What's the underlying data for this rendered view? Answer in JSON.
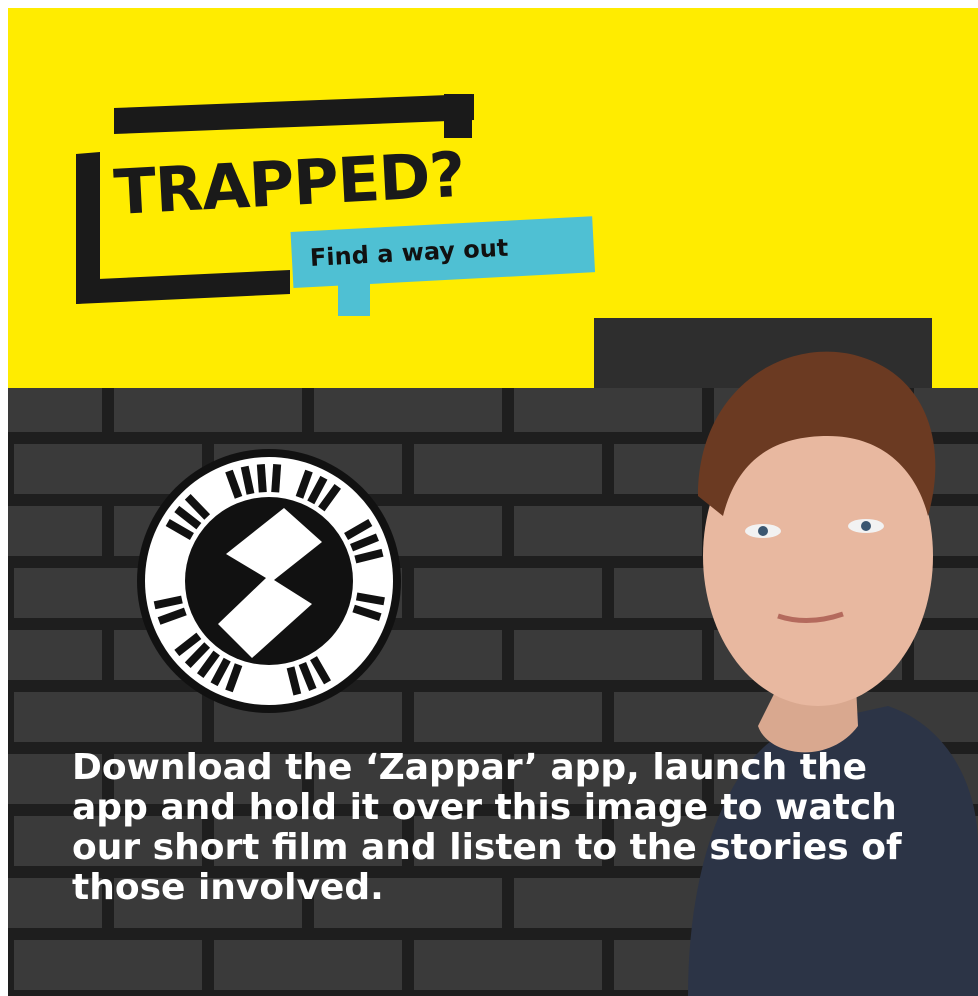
{
  "logo": {
    "title": "TRAPPED?",
    "subtitle": "Find a way out"
  },
  "zappar_icon": "zappar-icon",
  "caption": "Download the ‘Zappar’ app, launch the app and hold it over this image to watch our short film and listen to the stories of those involved.",
  "colors": {
    "yellow": "#ffec00",
    "bubble": "#4fc0d3",
    "brick": "#2b2b2b"
  }
}
